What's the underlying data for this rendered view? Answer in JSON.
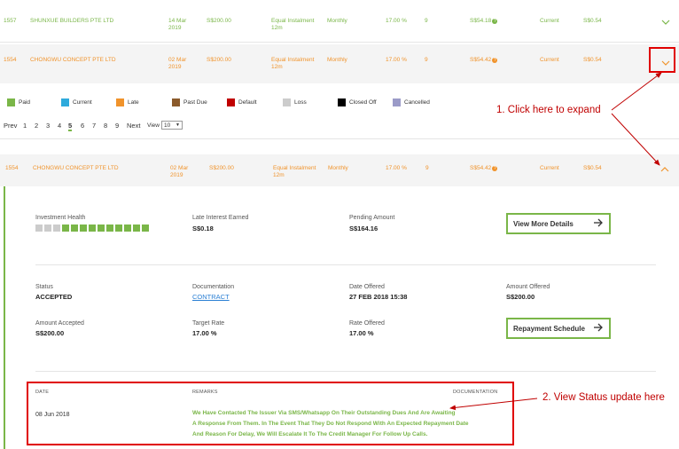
{
  "rows": [
    {
      "id": "1557",
      "company": "SHUNXUE BUILDERS PTE LTD",
      "date_line1": "14 Mar",
      "date_line2": "2019",
      "amount": "S$200.00",
      "type_line1": "Equal Instalment",
      "type_line2": "12m",
      "frequency": "Monthly",
      "rate": "17.00 %",
      "tenor": "9",
      "repayment": "S$54.18",
      "status": "Current",
      "interest": "S$0.54",
      "color": "#7ab648"
    },
    {
      "id": "1554",
      "company": "CHONGWU CONCEPT PTE LTD",
      "date_line1": "02 Mar",
      "date_line2": "2019",
      "amount": "S$200.00",
      "type_line1": "Equal Instalment",
      "type_line2": "12m",
      "frequency": "Monthly",
      "rate": "17.00 %",
      "tenor": "9",
      "repayment": "S$54.42",
      "status": "Current",
      "interest": "S$0.54",
      "color": "#f0932b"
    },
    {
      "id": "1554",
      "company": "CHONGWU CONCEPT PTE LTD",
      "date_line1": "02 Mar",
      "date_line2": "2019",
      "amount": "S$200.00",
      "type_line1": "Equal Instalment",
      "type_line2": "12m",
      "frequency": "Monthly",
      "rate": "17.00 %",
      "tenor": "9",
      "repayment": "S$54.42",
      "status": "Current",
      "interest": "S$0.54",
      "color": "#f0932b"
    }
  ],
  "legend": [
    {
      "label": "Paid",
      "color": "#7ab648"
    },
    {
      "label": "Current",
      "color": "#2eaadc"
    },
    {
      "label": "Late",
      "color": "#f0932b"
    },
    {
      "label": "Past Due",
      "color": "#8b5a2b"
    },
    {
      "label": "Default",
      "color": "#c00000"
    },
    {
      "label": "Loss",
      "color": "#cccccc"
    },
    {
      "label": "Closed Off",
      "color": "#000000"
    },
    {
      "label": "Cancelled",
      "color": "#9b9bc8"
    }
  ],
  "pager": {
    "prev": "Prev",
    "pages": [
      "1",
      "2",
      "3",
      "4",
      "5",
      "6",
      "7",
      "8",
      "9"
    ],
    "active": "5",
    "next": "Next",
    "view_label": "View",
    "view_value": "10"
  },
  "details": {
    "investment_health_label": "Investment Health",
    "health_bars": [
      "#cccccc",
      "#cccccc",
      "#cccccc",
      "#7ab648",
      "#7ab648",
      "#7ab648",
      "#7ab648",
      "#7ab648",
      "#7ab648",
      "#7ab648",
      "#7ab648",
      "#7ab648",
      "#7ab648"
    ],
    "late_interest_label": "Late Interest Earned",
    "late_interest_value": "S$0.18",
    "pending_amount_label": "Pending Amount",
    "pending_amount_value": "S$164.16",
    "view_more_button": "View More Details",
    "status_label": "Status",
    "status_value": "ACCEPTED",
    "documentation_label": "Documentation",
    "documentation_value": "CONTRACT",
    "date_offered_label": "Date Offered",
    "date_offered_value": "27 FEB 2018 15:38",
    "amount_offered_label": "Amount Offered",
    "amount_offered_value": "S$200.00",
    "amount_accepted_label": "Amount Accepted",
    "amount_accepted_value": "S$200.00",
    "target_rate_label": "Target Rate",
    "target_rate_value": "17.00 %",
    "rate_offered_label": "Rate Offered",
    "rate_offered_value": "17.00 %",
    "repayment_schedule_button": "Repayment Schedule"
  },
  "status_table": {
    "col_date": "DATE",
    "col_remarks": "REMARKS",
    "col_documentation": "DOCUMENTATION",
    "date": "08 Jun 2018",
    "remark_line1": "We Have Contacted The Issuer Via SMS/Whatsapp On Their Outstanding Dues And Are Awaiting",
    "remark_line2": "A Response From Them. In The Event That They Do Not Respond With An Expected Repayment Date",
    "remark_line3": "And Reason For Delay, We Will Escalate It To The Credit Manager For Follow Up Calls."
  },
  "annotations": {
    "step1": "1. Click here to expand",
    "step2": "2. View Status update here"
  },
  "icons": {
    "chevron_down": "chevron-down-icon",
    "chevron_up": "chevron-up-icon",
    "arrow_right": "arrow-right-icon",
    "info": "info-icon"
  }
}
